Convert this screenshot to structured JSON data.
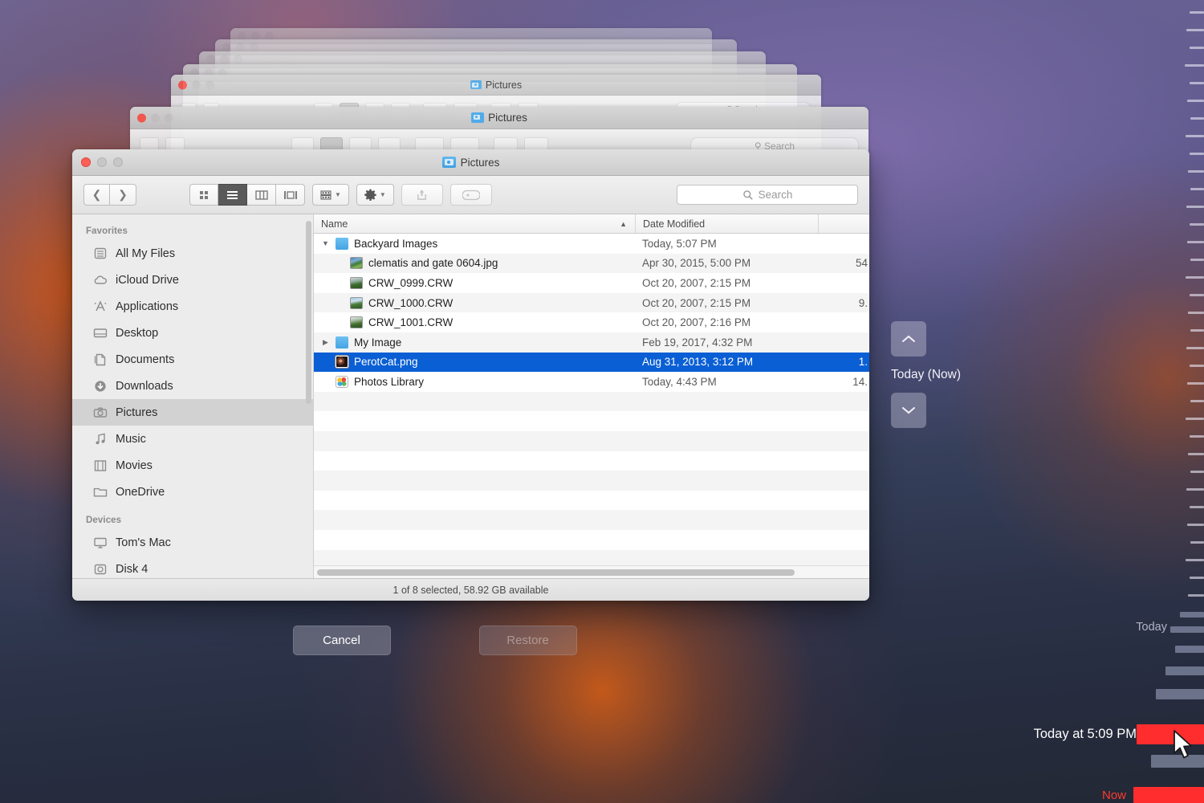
{
  "window": {
    "title": "Pictures",
    "folder_icon": "pictures-folder-icon",
    "traffic_lights": [
      "close",
      "minimize",
      "zoom"
    ]
  },
  "background_windows": [
    {
      "title": "Pictures"
    },
    {
      "title": "Pictures"
    },
    {
      "title": "Pictures"
    },
    {
      "title": "Pictures"
    },
    {
      "title": "Pictures"
    },
    {
      "title": "Pictures"
    }
  ],
  "toolbar": {
    "back_icon": "chevron-left-icon",
    "forward_icon": "chevron-right-icon",
    "views": [
      {
        "name": "icon-view",
        "icon": "grid-icon",
        "active": false
      },
      {
        "name": "list-view",
        "icon": "list-icon",
        "active": true
      },
      {
        "name": "column-view",
        "icon": "columns-icon",
        "active": false
      },
      {
        "name": "gallery-view",
        "icon": "coverflow-icon",
        "active": false
      }
    ],
    "arrange_icon": "arrange-grid-icon",
    "action_icon": "gear-icon",
    "share_icon": "share-icon",
    "tag_icon": "tag-icon",
    "search": {
      "placeholder": "Search",
      "value": "",
      "icon": "search-icon"
    }
  },
  "sidebar": {
    "sections": [
      {
        "header": "Favorites",
        "items": [
          {
            "label": "All My Files",
            "icon": "all-my-files-icon",
            "selected": false
          },
          {
            "label": "iCloud Drive",
            "icon": "cloud-icon",
            "selected": false
          },
          {
            "label": "Applications",
            "icon": "applications-icon",
            "selected": false
          },
          {
            "label": "Desktop",
            "icon": "desktop-icon",
            "selected": false
          },
          {
            "label": "Documents",
            "icon": "documents-icon",
            "selected": false
          },
          {
            "label": "Downloads",
            "icon": "downloads-icon",
            "selected": false
          },
          {
            "label": "Pictures",
            "icon": "pictures-icon",
            "selected": true
          },
          {
            "label": "Music",
            "icon": "music-icon",
            "selected": false
          },
          {
            "label": "Movies",
            "icon": "movies-icon",
            "selected": false
          },
          {
            "label": "OneDrive",
            "icon": "folder-icon",
            "selected": false
          }
        ]
      },
      {
        "header": "Devices",
        "items": [
          {
            "label": "Tom's Mac",
            "icon": "computer-icon",
            "selected": false
          },
          {
            "label": "Disk 4",
            "icon": "disk-icon",
            "selected": false
          }
        ]
      }
    ]
  },
  "file_list": {
    "columns": [
      {
        "label": "Name",
        "sorted": true,
        "sort_icon": "chevron-up-icon"
      },
      {
        "label": "Date Modified",
        "sorted": false
      },
      {
        "label": "",
        "sorted": false
      }
    ],
    "rows": [
      {
        "name": "Backyard Images",
        "date": "Today, 5:07 PM",
        "size": "",
        "icon": "folder-icon",
        "depth": 0,
        "twisty": "expanded",
        "selected": false
      },
      {
        "name": "clematis and gate 0604.jpg",
        "date": "Apr 30, 2015, 5:00 PM",
        "size": "54",
        "icon": "image-file-icon",
        "depth": 1,
        "twisty": "none",
        "selected": false
      },
      {
        "name": "CRW_0999.CRW",
        "date": "Oct 20, 2007, 2:15 PM",
        "size": "",
        "icon": "raw-file-icon",
        "depth": 1,
        "twisty": "none",
        "selected": false
      },
      {
        "name": "CRW_1000.CRW",
        "date": "Oct 20, 2007, 2:15 PM",
        "size": "9.",
        "icon": "raw-file-icon",
        "depth": 1,
        "twisty": "none",
        "selected": false
      },
      {
        "name": "CRW_1001.CRW",
        "date": "Oct 20, 2007, 2:16 PM",
        "size": "",
        "icon": "raw-file-icon",
        "depth": 1,
        "twisty": "none",
        "selected": false
      },
      {
        "name": "My Image",
        "date": "Feb 19, 2017, 4:32 PM",
        "size": "",
        "icon": "folder-icon",
        "depth": 0,
        "twisty": "collapsed",
        "selected": false
      },
      {
        "name": "PerotCat.png",
        "date": "Aug 31, 2013, 3:12 PM",
        "size": "1.",
        "icon": "png-file-icon",
        "depth": 0,
        "twisty": "none",
        "selected": true
      },
      {
        "name": "Photos Library",
        "date": "Today, 4:43 PM",
        "size": "14.",
        "icon": "photos-library-icon",
        "depth": 0,
        "twisty": "none",
        "selected": false
      }
    ]
  },
  "statusbar": {
    "text": "1 of 8 selected, 58.92 GB available"
  },
  "actions": {
    "cancel_label": "Cancel",
    "restore_label": "Restore",
    "restore_disabled": true
  },
  "time_machine": {
    "up_arrow_icon": "chevron-up-icon",
    "down_arrow_icon": "chevron-down-icon",
    "current_label": "Today (Now)",
    "selected_backup_label": "Today at 5:09 PM",
    "timeline_labels": {
      "today": "Today",
      "now": "Now"
    },
    "cursor_icon": "arrow-cursor"
  },
  "colors": {
    "selection_blue": "#0A5FD4",
    "timeline_red": "#FF2D2D",
    "now_red": "#FF3B30",
    "close_button_red": "#FF5F57",
    "folder_blue": "#44A4E3"
  }
}
